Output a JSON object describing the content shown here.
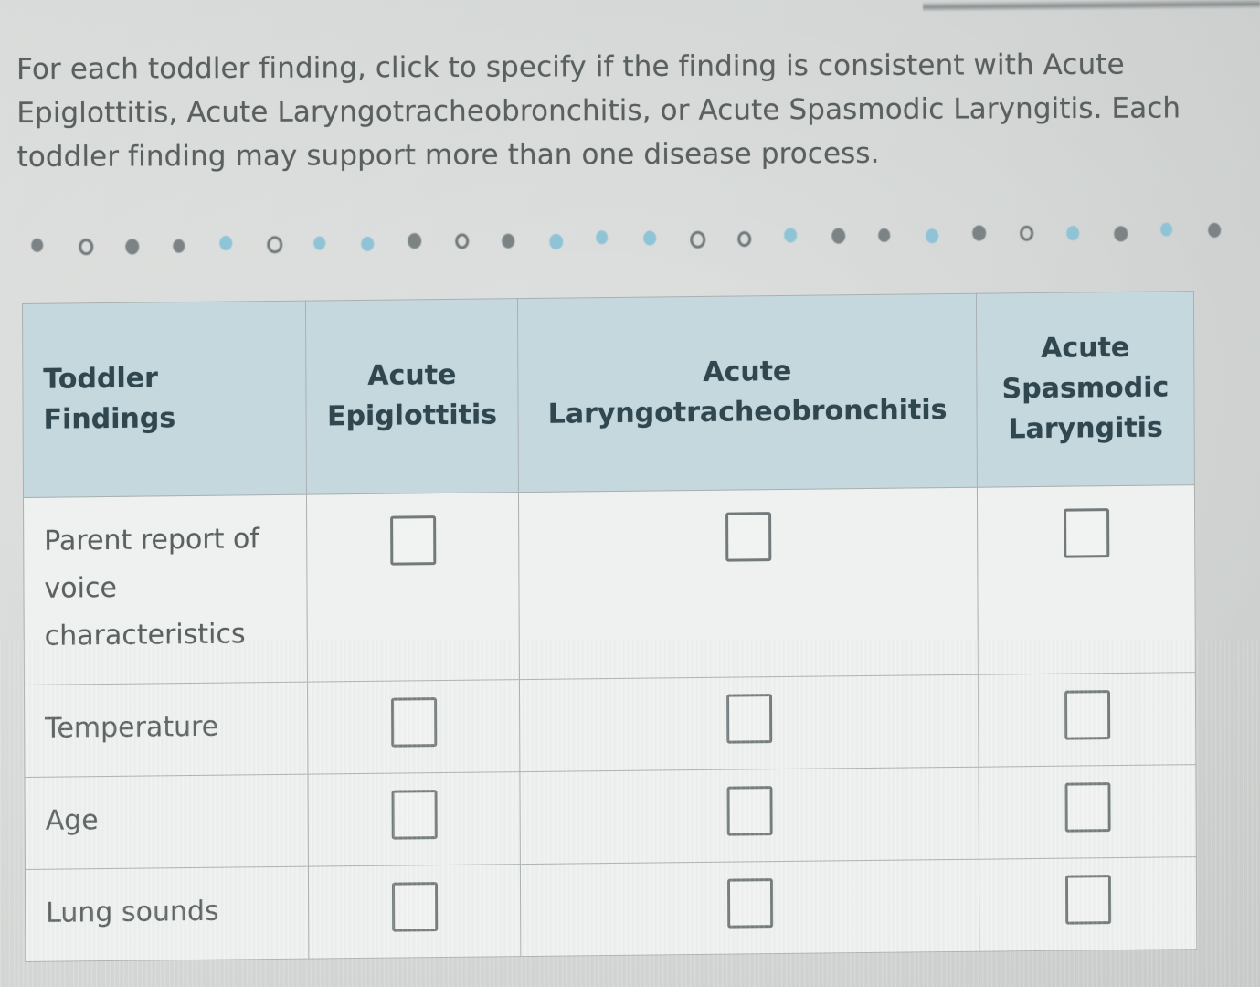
{
  "prompt": {
    "text": "For each toddler finding, click to specify if the finding is consistent with Acute Epiglottitis, Acute Laryngotracheobronchitis, or Acute Spasmodic Laryngitis. Each toddler finding may support more than one disease process."
  },
  "progress_dots": {
    "count": 28,
    "colors": {
      "gray_filled": "#7c8384",
      "gray_hollow": "#6f7779",
      "blue_filled": "#8fc3d6",
      "blue_hollow": "#8fc3d6"
    },
    "items": [
      {
        "style": "gray-filled"
      },
      {
        "style": "gray-hollow"
      },
      {
        "style": "gray-filled"
      },
      {
        "style": "gray-filled"
      },
      {
        "style": "blue-filled"
      },
      {
        "style": "gray-hollow"
      },
      {
        "style": "blue-filled"
      },
      {
        "style": "blue-filled"
      },
      {
        "style": "gray-filled"
      },
      {
        "style": "gray-hollow"
      },
      {
        "style": "gray-filled"
      },
      {
        "style": "blue-filled"
      },
      {
        "style": "blue-filled"
      },
      {
        "style": "blue-filled"
      },
      {
        "style": "gray-hollow"
      },
      {
        "style": "gray-hollow"
      },
      {
        "style": "blue-filled"
      },
      {
        "style": "gray-filled"
      },
      {
        "style": "gray-filled"
      },
      {
        "style": "blue-filled"
      },
      {
        "style": "gray-filled"
      },
      {
        "style": "gray-hollow"
      },
      {
        "style": "blue-filled"
      },
      {
        "style": "gray-filled"
      },
      {
        "style": "blue-filled"
      },
      {
        "style": "gray-filled"
      }
    ]
  },
  "table": {
    "header_bg": "#c4d8de",
    "body_bg": "#eef1f0",
    "border_color": "#a9b0b1",
    "headers": [
      "Toddler Findings",
      "Acute Epiglottitis",
      "Acute Laryngotracheobronchitis",
      "Acute Spasmodic Laryngitis"
    ],
    "headers_lines": {
      "h0_l1": "Toddler",
      "h0_l2": "Findings",
      "h1_l1": "Acute",
      "h1_l2": "Epiglottitis",
      "h2_l1": "Acute",
      "h2_l2": "Laryngotracheobronchitis",
      "h3_l1": "Acute",
      "h3_l2": "Spasmodic",
      "h3_l3": "Laryngitis"
    },
    "rows": [
      {
        "finding": "Parent report of voice characteristics",
        "epiglottitis_checked": false,
        "ltb_checked": false,
        "spasmodic_checked": false
      },
      {
        "finding": "Temperature",
        "epiglottitis_checked": false,
        "ltb_checked": false,
        "spasmodic_checked": false
      },
      {
        "finding": "Age",
        "epiglottitis_checked": false,
        "ltb_checked": false,
        "spasmodic_checked": false
      },
      {
        "finding": "Lung sounds",
        "epiglottitis_checked": false,
        "ltb_checked": false,
        "spasmodic_checked": false
      }
    ]
  }
}
